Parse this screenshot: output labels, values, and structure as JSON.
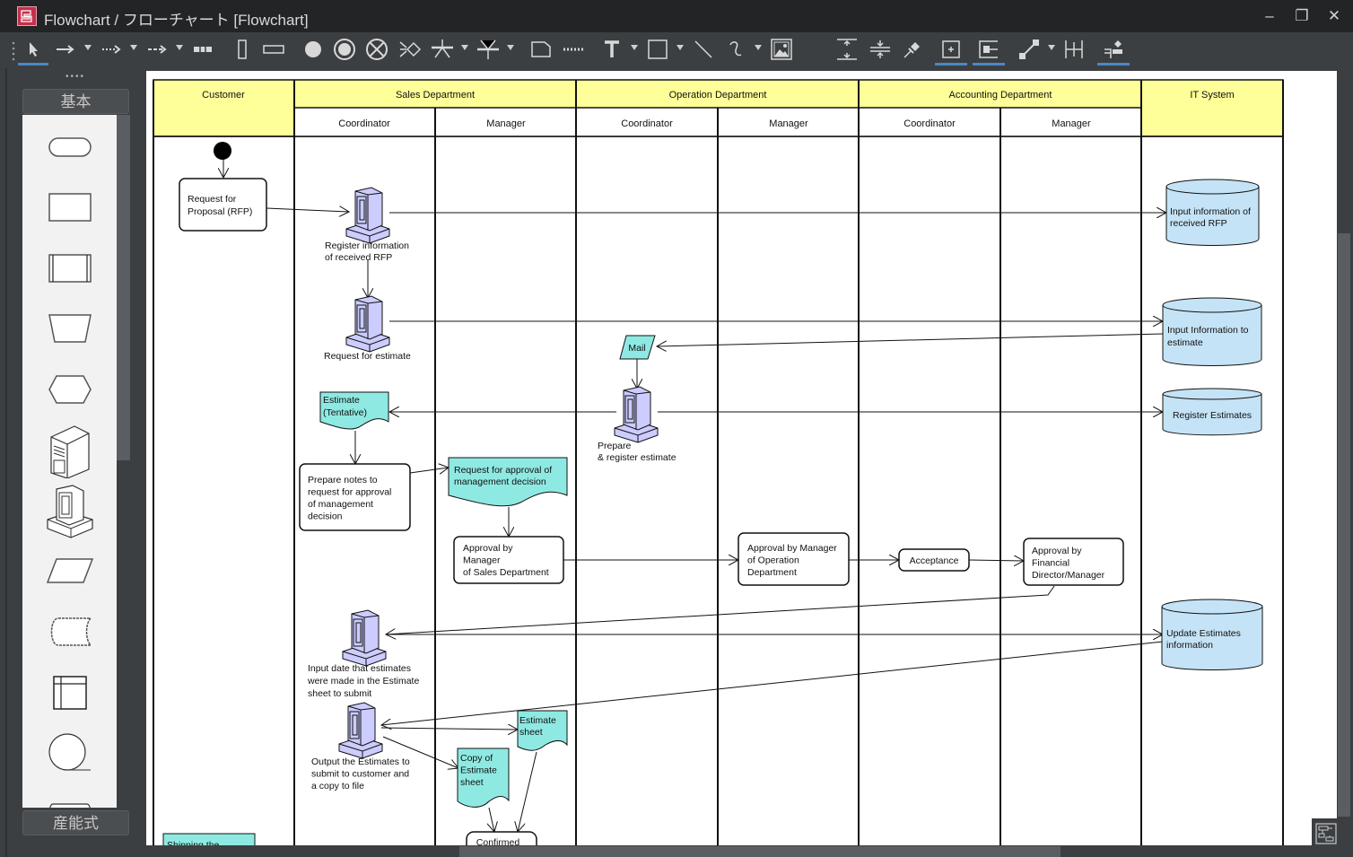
{
  "window": {
    "title": "Flowchart / フローチャート [Flowchart]",
    "controls": {
      "minimize": "–",
      "restore": "❐",
      "close": "✕"
    }
  },
  "toolbar": {
    "tools": [
      {
        "name": "select-tool",
        "icon": "pointer-icon",
        "active": true
      },
      {
        "name": "flow-arrow-tool",
        "icon": "solid-arrow-icon",
        "has_dropdown": true
      },
      {
        "name": "dotted-arrow-tool",
        "icon": "dotted-arrow-icon",
        "has_dropdown": true
      },
      {
        "name": "dashed-arrow-tool",
        "icon": "dashed-arrow-icon",
        "has_dropdown": true
      },
      {
        "name": "swimlane-horizontal-tool",
        "icon": "lane-icon"
      },
      {
        "name": "vertical-lane-tool",
        "icon": "vertical-rect-icon"
      },
      {
        "name": "horizontal-lane-tool",
        "icon": "horizontal-rect-icon"
      },
      {
        "name": "start-node-tool",
        "icon": "filled-circle-icon"
      },
      {
        "name": "end-node-tool",
        "icon": "double-circle-icon"
      },
      {
        "name": "flow-final-tool",
        "icon": "crossed-circle-icon"
      },
      {
        "name": "decision-tool",
        "icon": "merge-icon"
      },
      {
        "name": "fork-tool",
        "icon": "fork-icon",
        "has_dropdown": true
      },
      {
        "name": "join-tool",
        "icon": "join-icon",
        "has_dropdown": true
      },
      {
        "name": "note-tool",
        "icon": "note-icon"
      },
      {
        "name": "note-anchor-tool",
        "icon": "dotted-line-icon"
      },
      {
        "name": "text-tool",
        "icon": "text-icon",
        "has_dropdown": true
      },
      {
        "name": "rectangle-tool",
        "icon": "rectangle-icon",
        "has_dropdown": true
      },
      {
        "name": "line-tool",
        "icon": "line-icon"
      },
      {
        "name": "freehand-tool",
        "icon": "curve-icon",
        "has_dropdown": true
      },
      {
        "name": "image-tool",
        "icon": "image-icon"
      },
      {
        "name": "expand-space-tool",
        "icon": "expand-vertical-icon"
      },
      {
        "name": "shrink-space-tool",
        "icon": "shrink-vertical-icon"
      },
      {
        "name": "pin-tool",
        "icon": "pin-icon"
      },
      {
        "name": "auto-resize-tool",
        "icon": "add-box-icon",
        "active": true
      },
      {
        "name": "fit-tool",
        "icon": "fit-box-icon",
        "active": true
      },
      {
        "name": "line-style-tool",
        "icon": "connector-icon",
        "has_dropdown": true
      },
      {
        "name": "align-tool",
        "icon": "align-icon"
      },
      {
        "name": "snap-tool",
        "icon": "snap-icon",
        "active": true
      }
    ]
  },
  "palette": {
    "top_tab": "基本",
    "bottom_tab": "産能式",
    "shapes": [
      "terminal-shape",
      "process-shape",
      "predefined-process-shape",
      "manual-operation-shape",
      "preparation-shape",
      "server-shape",
      "computer-terminal-shape",
      "data-shape",
      "stored-data-shape",
      "internal-storage-shape",
      "sequential-access-shape",
      "direct-access-shape"
    ]
  },
  "diagram": {
    "colors": {
      "header": "#ffff99",
      "document": "#8fe9e3",
      "database": "#c5e3f6",
      "computer": "#ccccff"
    },
    "lanes": {
      "customer": "Customer",
      "sales": "Sales Department",
      "operation": "Operation Department",
      "accounting": "Accounting Department",
      "it": "IT System",
      "coordinator": "Coordinator",
      "manager": "Manager"
    },
    "nodes": {
      "rfp": [
        "Request for",
        "Proposal (RFP)"
      ],
      "register_rfp": [
        "Register information",
        "of received RFP"
      ],
      "request_estimate": [
        "Request for estimate"
      ],
      "mail": "Mail",
      "prepare_register": [
        "Prepare",
        "& register estimate"
      ],
      "estimate_tentative": [
        "Estimate",
        "(Tentative)"
      ],
      "prepare_notes": [
        "Prepare notes to",
        "request for approval",
        "of  management",
        "decision"
      ],
      "request_approval_doc": [
        "Request  for approval of",
        "management decision"
      ],
      "approval_sales": [
        "Approval by",
        "Manager",
        "of Sales Department"
      ],
      "approval_operation": [
        "Approval by Manager",
        "of Operation",
        "Department"
      ],
      "acceptance": "Acceptance",
      "approval_financial": [
        "Approval by",
        "Financial",
        "Director/Manager"
      ],
      "input_date": [
        "Input date that estimates",
        "were made in the Estimate",
        "sheet to submit"
      ],
      "output_estimates": [
        "Output the Estimates to",
        "submit to customer and",
        "a copy to file"
      ],
      "estimate_sheet": [
        "Estimate",
        "sheet"
      ],
      "copy_estimate": [
        "Copy of",
        "Estimate",
        "sheet"
      ],
      "confirmed": "Confirmed",
      "shipping": "Shipping the",
      "db_rfp": [
        "Input information of",
        "received RFP"
      ],
      "db_estimate": [
        "Input Information to",
        "estimate"
      ],
      "db_register": [
        "Register Estimates"
      ],
      "db_update": [
        "Update Estimates",
        "information"
      ]
    }
  }
}
